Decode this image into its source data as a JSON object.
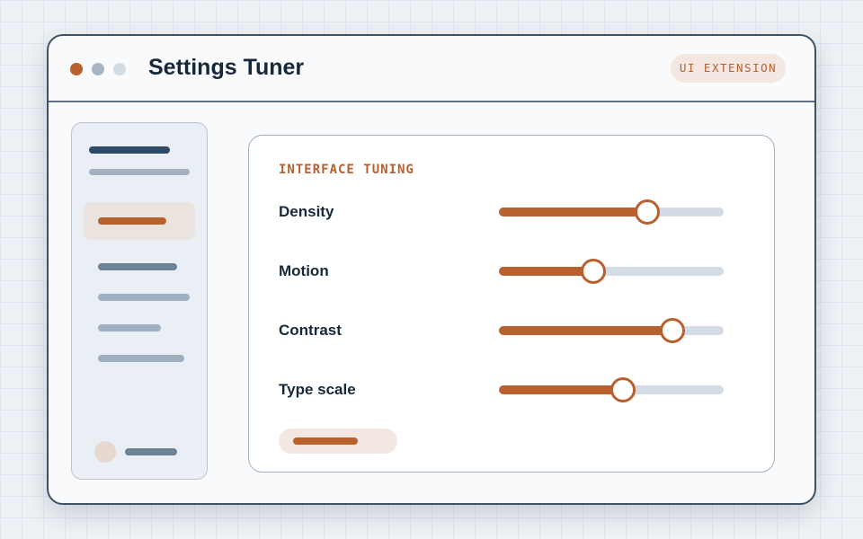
{
  "window": {
    "title": "Settings Tuner",
    "badge": "UI EXTENSION",
    "traffic_lights": [
      "#b9602f",
      "#a7b4c2",
      "#d3dce5"
    ]
  },
  "panel": {
    "section_title": "INTERFACE TUNING",
    "sliders": [
      {
        "label": "Density",
        "value_fraction": 0.66
      },
      {
        "label": "Motion",
        "value_fraction": 0.42
      },
      {
        "label": "Contrast",
        "value_fraction": 0.77
      },
      {
        "label": "Type scale",
        "value_fraction": 0.55
      }
    ]
  },
  "colors": {
    "accent": "#b9602f",
    "accent_soft": "#f4e6e0",
    "text_dark": "#17283b",
    "track": "#d3dce4"
  }
}
